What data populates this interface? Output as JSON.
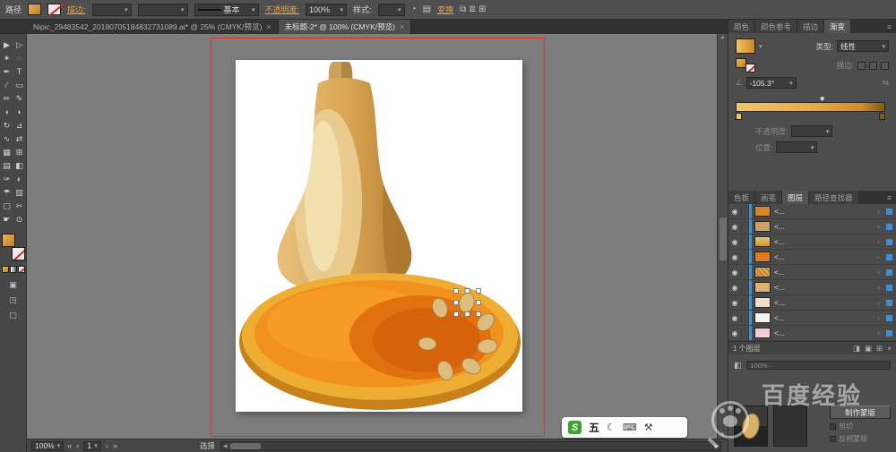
{
  "colors": {
    "accent_orange": "#e8a33c",
    "selection_blue": "#3f8fd6",
    "artboard_red": "#d23b2f"
  },
  "icons": {
    "menu": "≡",
    "carat": "▾",
    "eye": "◉",
    "close": "×",
    "angle": "∠",
    "reverse": "⇆",
    "recolor": "◔",
    "half": "◧",
    "first": "«",
    "prev": "‹",
    "next": "›",
    "last": "»",
    "left": "◀",
    "right": "▶",
    "up": "▲",
    "down": "▼",
    "target": "◦",
    "diamond": "◆",
    "moon": "☾",
    "keyboard": "⌨",
    "toolbox": "⚒",
    "dock": "▤",
    "align": "⧉ ≣ ⊞"
  },
  "topbar": {
    "context_label": "路径",
    "stroke_link": "描边:",
    "brush_style": "基本",
    "opacity_link": "不透明度:",
    "opacity_value": "100%",
    "style_label": "样式:",
    "transform_link": "变换"
  },
  "tabs": {
    "doc1": "Nipic_29483542_20190705184832731089.ai* @ 25% (CMYK/预览)",
    "doc2": "未标题-2* @ 100% (CMYK/预览)"
  },
  "tools": [
    {
      "name": "selection-tool",
      "glyph": "▶"
    },
    {
      "name": "direct-selection-tool",
      "glyph": "▷"
    },
    {
      "name": "magic-wand-tool",
      "glyph": "✶"
    },
    {
      "name": "lasso-tool",
      "glyph": "◌"
    },
    {
      "name": "pen-tool",
      "glyph": "✒"
    },
    {
      "name": "type-tool",
      "glyph": "T"
    },
    {
      "name": "line-segment-tool",
      "glyph": "∕"
    },
    {
      "name": "rectangle-tool",
      "glyph": "▭"
    },
    {
      "name": "paintbrush-tool",
      "glyph": "✏"
    },
    {
      "name": "pencil-tool",
      "glyph": "✎"
    },
    {
      "name": "blob-brush-tool",
      "glyph": "◖"
    },
    {
      "name": "eraser-tool",
      "glyph": "◗"
    },
    {
      "name": "rotate-tool",
      "glyph": "↻"
    },
    {
      "name": "scale-tool",
      "glyph": "⊿"
    },
    {
      "name": "width-tool",
      "glyph": "∿"
    },
    {
      "name": "free-transform-tool",
      "glyph": "⇄"
    },
    {
      "name": "shape-builder-tool",
      "glyph": "▦"
    },
    {
      "name": "perspective-grid-tool",
      "glyph": "⊞"
    },
    {
      "name": "mesh-tool",
      "glyph": "▤"
    },
    {
      "name": "gradient-tool",
      "glyph": "◧"
    },
    {
      "name": "eyedropper-tool",
      "glyph": "✑"
    },
    {
      "name": "blend-tool",
      "glyph": "◐"
    },
    {
      "name": "symbol-sprayer-tool",
      "glyph": "☂"
    },
    {
      "name": "column-graph-tool",
      "glyph": "▥"
    },
    {
      "name": "artboard-tool",
      "glyph": "▢"
    },
    {
      "name": "slice-tool",
      "glyph": "✂"
    },
    {
      "name": "hand-tool",
      "glyph": "☛"
    },
    {
      "name": "zoom-tool",
      "glyph": "⊙"
    }
  ],
  "gradient_panel": {
    "tabs": [
      "颜色",
      "颜色参考",
      "描边",
      "渐变"
    ],
    "type_label": "类型:",
    "type_value": "线性",
    "stroke_label": "描边:",
    "angle_value": "-105.3°",
    "opacity_label": "不透明度:",
    "position_label": "位置:",
    "bar_css": "background:linear-gradient(90deg,#f0c568,#e7a93e 55%,#d18a27 85%,#7e5b18)"
  },
  "layers_panel": {
    "tabs": [
      "色板",
      "画笔",
      "图层",
      "路径查找器"
    ],
    "rows": [
      {
        "label": "<...",
        "thumb_style": "background:#d4862b"
      },
      {
        "label": "<...",
        "thumb_style": "background:#c9a164"
      },
      {
        "label": "<...",
        "thumb_style": "background:linear-gradient(180deg,#edc76a,#c89434)"
      },
      {
        "label": "<...",
        "thumb_style": "background:#dd7d1f"
      },
      {
        "label": "<...",
        "thumb_style": "background:repeating-linear-gradient(45deg,#d8a855 0 2px,#b98738 2px 4px)"
      },
      {
        "label": "<...",
        "thumb_style": "background:#dcb272"
      },
      {
        "label": "<...",
        "thumb_style": "background:#f2ddc9"
      },
      {
        "label": "<...",
        "thumb_style": "background:#f7f3ee"
      },
      {
        "label": "<...",
        "thumb_style": "background:#f0cdd8"
      }
    ],
    "footer": "1 个图层",
    "footer_icons": [
      "◨",
      "▣",
      "⊞",
      "×"
    ]
  },
  "transparency_panel": {
    "opacity_value": "100%",
    "make_mask_button": "制作蒙版",
    "clip_label": "剪切",
    "invert_label": "反相蒙版"
  },
  "statusbar": {
    "zoom": "100%",
    "artboard": "1",
    "mode_label": "选择"
  },
  "ime": {
    "logo": "S",
    "mode": "五"
  },
  "watermark": {
    "text": "百度经验"
  }
}
